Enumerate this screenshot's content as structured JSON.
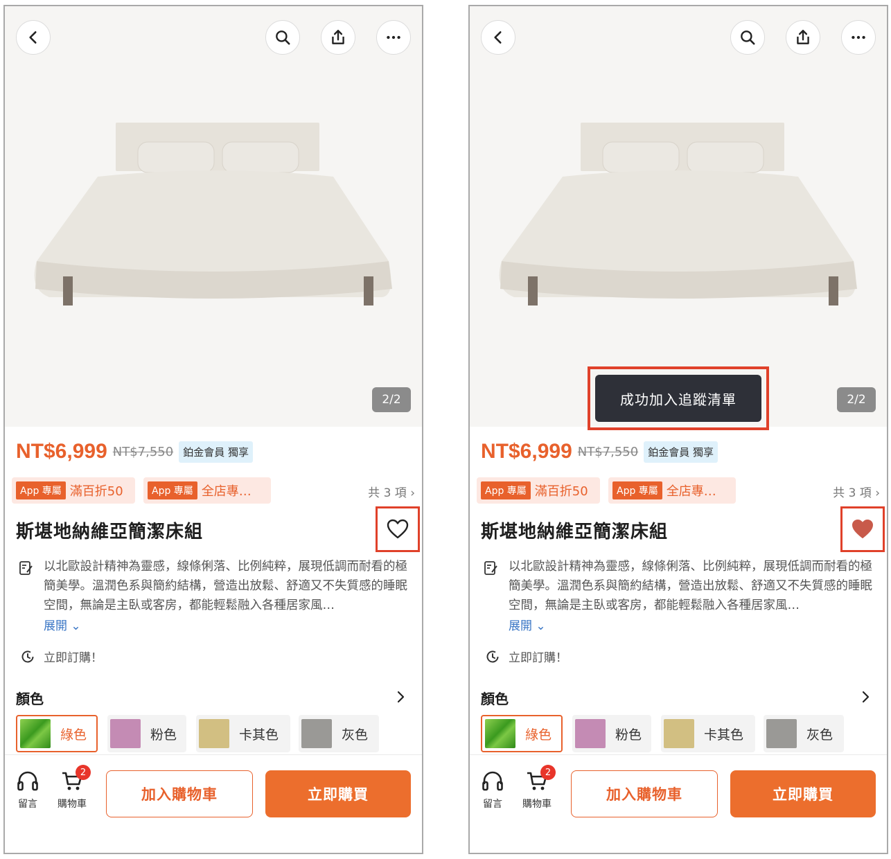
{
  "screens": [
    {
      "page_counter": "2/2",
      "toast": "",
      "favorited": false,
      "price": "NT$6,999",
      "original_price": "NT$7,550",
      "member_badge": "鉑金會員 獨享",
      "coupons": [
        {
          "tag": "App 專屬",
          "text": "滿百折50"
        },
        {
          "tag": "App 專屬",
          "text": "全店專…"
        }
      ],
      "coupon_count": "共 3 項 ›",
      "title": "斯堪地納維亞簡潔床組",
      "description": "以北歐設計精神為靈感，線條俐落、比例純粹，展現低調而耐看的極簡美學。溫潤色系與簡約結構，營造出放鬆、舒適又不失質感的睡眠空間，無論是主臥或客房，都能輕鬆融入各種居家風…",
      "expand_label": "展開 ⌄",
      "order_label": "立即訂購！",
      "color_label": "顏色",
      "colors": [
        {
          "label": "綠色",
          "selected": true
        },
        {
          "label": "粉色",
          "selected": false
        },
        {
          "label": "卡其色",
          "selected": false
        },
        {
          "label": "灰色",
          "selected": false
        }
      ],
      "bottom": {
        "message_label": "留言",
        "cart_label": "購物車",
        "cart_badge": "2",
        "add_to_cart": "加入購物車",
        "buy_now": "立即購買"
      }
    },
    {
      "page_counter": "2/2",
      "toast": "成功加入追蹤清單",
      "favorited": true,
      "price": "NT$6,999",
      "original_price": "NT$7,550",
      "member_badge": "鉑金會員 獨享",
      "coupons": [
        {
          "tag": "App 專屬",
          "text": "滿百折50"
        },
        {
          "tag": "App 專屬",
          "text": "全店專…"
        }
      ],
      "coupon_count": "共 3 項 ›",
      "title": "斯堪地納維亞簡潔床組",
      "description": "以北歐設計精神為靈感，線條俐落、比例純粹，展現低調而耐看的極簡美學。溫潤色系與簡約結構，營造出放鬆、舒適又不失質感的睡眠空間，無論是主臥或客房，都能輕鬆融入各種居家風…",
      "expand_label": "展開 ⌄",
      "order_label": "立即訂購！",
      "color_label": "顏色",
      "colors": [
        {
          "label": "綠色",
          "selected": true
        },
        {
          "label": "粉色",
          "selected": false
        },
        {
          "label": "卡其色",
          "selected": false
        },
        {
          "label": "灰色",
          "selected": false
        }
      ],
      "bottom": {
        "message_label": "留言",
        "cart_label": "購物車",
        "cart_badge": "2",
        "add_to_cart": "加入購物車",
        "buy_now": "立即購買"
      }
    }
  ],
  "colors": {
    "accent": "#e8612c",
    "highlight_border": "#e0412a",
    "heart_filled": "#c85a4a",
    "swatch_green": "#4caf2a",
    "swatch_pink": "#c48bb4",
    "swatch_khaki": "#d2bf82",
    "swatch_gray": "#9a9996"
  },
  "icons": [
    "back-icon",
    "search-icon",
    "share-icon",
    "more-icon",
    "heart-icon",
    "description-icon",
    "clock-icon",
    "chevron-right-icon",
    "headset-icon",
    "cart-icon"
  ]
}
